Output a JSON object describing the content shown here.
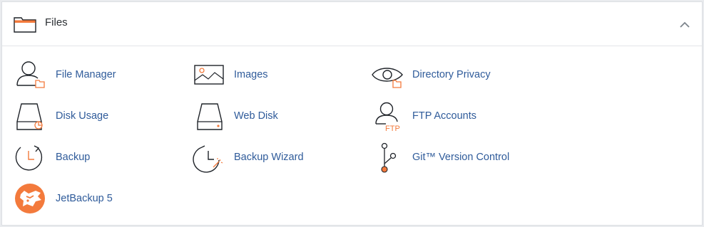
{
  "panel": {
    "title": "Files",
    "folder_icon": "folder-icon",
    "toggle_icon": "chevron-up-icon"
  },
  "items": [
    {
      "label": "File Manager",
      "icon": "file-manager-icon"
    },
    {
      "label": "Images",
      "icon": "images-icon"
    },
    {
      "label": "Directory Privacy",
      "icon": "directory-privacy-icon"
    },
    {
      "label": "Disk Usage",
      "icon": "disk-usage-icon"
    },
    {
      "label": "Web Disk",
      "icon": "web-disk-icon"
    },
    {
      "label": "FTP Accounts",
      "icon": "ftp-accounts-icon",
      "icon_text": "FTP"
    },
    {
      "label": "Backup",
      "icon": "backup-icon"
    },
    {
      "label": "Backup Wizard",
      "icon": "backup-wizard-icon"
    },
    {
      "label": "Git™ Version Control",
      "icon": "git-icon"
    },
    {
      "label": "JetBackup 5",
      "icon": "jetbackup-icon"
    }
  ],
  "colors": {
    "link": "#2f5b9a",
    "accent": "#f37a3c",
    "icon_stroke": "#1f2329"
  }
}
